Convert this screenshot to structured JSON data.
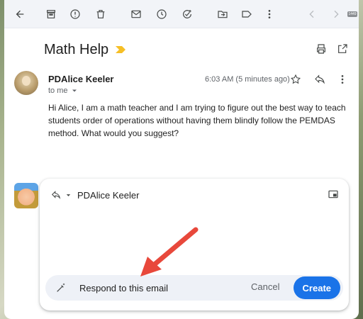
{
  "email": {
    "subject": "Math Help",
    "sender": "PDAlice Keeler",
    "recipient_line": "to me",
    "timestamp": "6:03 AM (5 minutes ago)",
    "body": "Hi Alice, I am a math teacher and I am trying to figure out the best way to teach students order of operations without having them blindly follow the PEMDAS method. What would you suggest?"
  },
  "reply": {
    "recipient": "PDAlice Keeler",
    "help_me_write": {
      "prompt_value": "Respond to this email",
      "cancel_label": "Cancel",
      "create_label": "Create"
    }
  },
  "toolbar_pill": "1449",
  "colors": {
    "accent": "#1a73e8",
    "importance": "#f6bf26",
    "annotation_arrow": "#e8483b"
  },
  "icons": {
    "toolbar": [
      "back-icon",
      "archive-icon",
      "report-spam-icon",
      "delete-icon",
      "mark-unread-icon",
      "snooze-icon",
      "add-task-icon",
      "move-to-icon",
      "label-icon",
      "more-vert-icon",
      "prev-icon",
      "next-icon"
    ],
    "header": [
      "print-icon",
      "open-new-window-icon"
    ],
    "message": [
      "star-icon",
      "reply-icon",
      "more-vert-icon"
    ]
  }
}
